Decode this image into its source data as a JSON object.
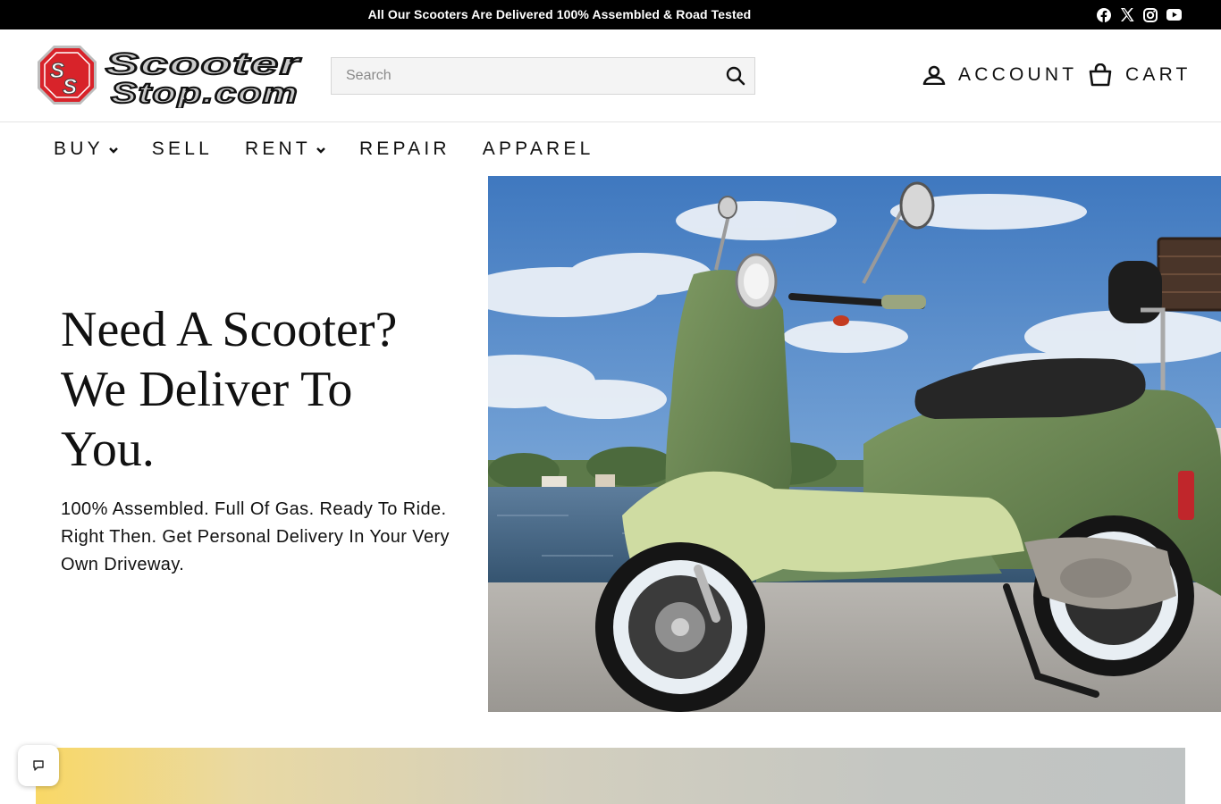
{
  "announcement": {
    "text": "All Our Scooters Are Delivered 100% Assembled & Road Tested"
  },
  "socials": [
    {
      "name": "facebook-icon"
    },
    {
      "name": "x-icon"
    },
    {
      "name": "instagram-icon"
    },
    {
      "name": "youtube-icon"
    }
  ],
  "header": {
    "logo_text_line1": "Scooter",
    "logo_text_line2": "Stop.com",
    "logo_mark": "SS",
    "search_placeholder": "Search",
    "account_label": "ACCOUNT",
    "cart_label": "CART"
  },
  "nav": {
    "buy": "BUY",
    "sell": "SELL",
    "rent": "RENT",
    "repair": "REPAIR",
    "apparel": "APPAREL"
  },
  "hero": {
    "title": "Need A Scooter? We Deliver To You.",
    "subtitle": "100% Assembled. Full Of Gas. Ready To Ride. Right Then. Get Personal Delivery In Your Very Own Driveway."
  },
  "colors": {
    "announce_bg": "#000000",
    "logo_red": "#d8232a",
    "scooter_green": "#6b8453",
    "scooter_cream": "#cfdca2",
    "sky": "#4f86c6"
  }
}
